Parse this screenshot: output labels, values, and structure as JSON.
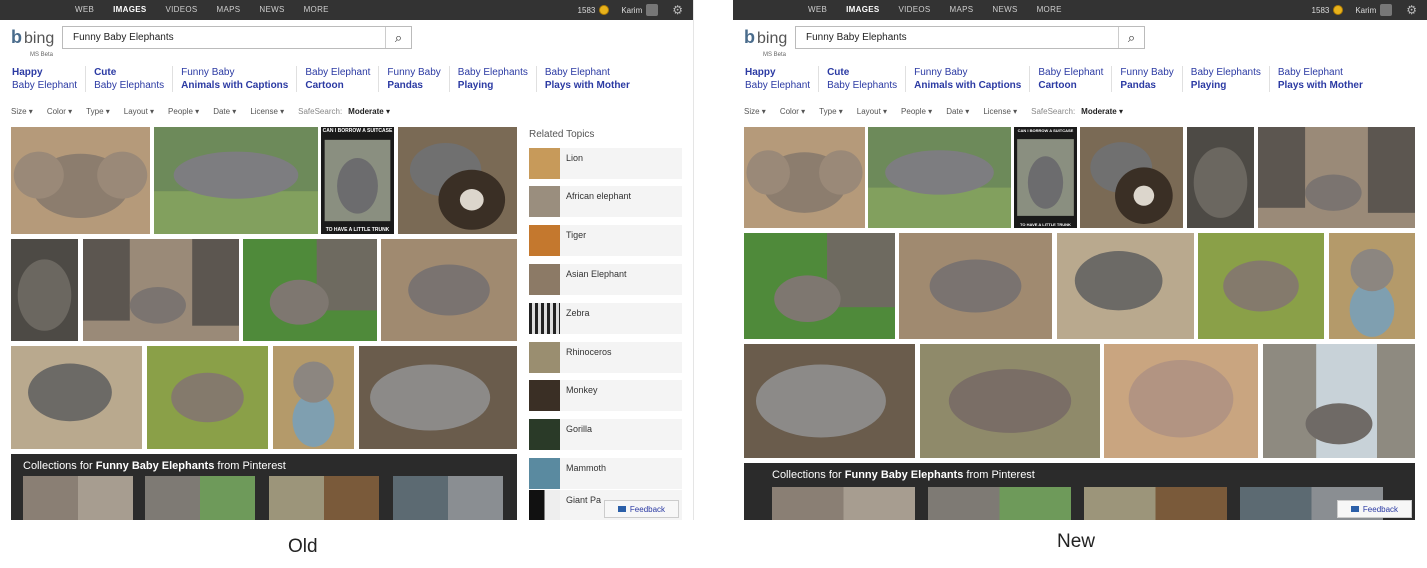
{
  "nav": [
    "WEB",
    "IMAGES",
    "VIDEOS",
    "MAPS",
    "NEWS",
    "MORE"
  ],
  "nav_active": "IMAGES",
  "points": "1583",
  "username": "Karim",
  "logo_text": "bing",
  "beta_label": "MS Beta",
  "query": "Funny Baby Elephants",
  "related_searches": [
    {
      "l1": "Happy",
      "l2": "Baby Elephant",
      "b1": true,
      "b2": false
    },
    {
      "l1": "Cute",
      "l2": "Baby Elephants",
      "b1": true,
      "b2": false
    },
    {
      "l1": "Funny Baby",
      "l2": "Animals with Captions",
      "b1": false,
      "b2": true
    },
    {
      "l1": "Baby Elephant",
      "l2": "Cartoon",
      "b1": false,
      "b2": true
    },
    {
      "l1": "Funny Baby",
      "l2": "Pandas",
      "b1": false,
      "b2": true
    },
    {
      "l1": "Baby Elephants",
      "l2": "Playing",
      "b1": false,
      "b2": true
    },
    {
      "l1": "Baby Elephant",
      "l2": "Plays with Mother",
      "b1": false,
      "b2": true
    }
  ],
  "filters": [
    "Size ▾",
    "Color ▾",
    "Type ▾",
    "Layout ▾",
    "People ▾",
    "Date ▾",
    "License ▾"
  ],
  "safesearch_label": "SafeSearch:",
  "safesearch_value": "Moderate ▾",
  "related_topics_title": "Related Topics",
  "related_topics": [
    "Lion",
    "African elephant",
    "Tiger",
    "Asian Elephant",
    "Zebra",
    "Rhinoceros",
    "Monkey",
    "Gorilla",
    "Mammoth",
    "Giant Pa"
  ],
  "collections": {
    "prefix": "Collections for ",
    "query": "Funny Baby Elephants",
    "suffix": " from Pinterest"
  },
  "image_captions": {
    "suitcase_top": "CAN I BORROW A SUITCASE",
    "suitcase_bottom": "TO HAVE A LITTLE TRUNK"
  },
  "feedback": "Feedback",
  "labels": {
    "old": "Old",
    "new": "New"
  },
  "colors": {
    "topbar": "#333333",
    "link": "#2b3aa3",
    "collections_bg": "#2b2b2b"
  }
}
